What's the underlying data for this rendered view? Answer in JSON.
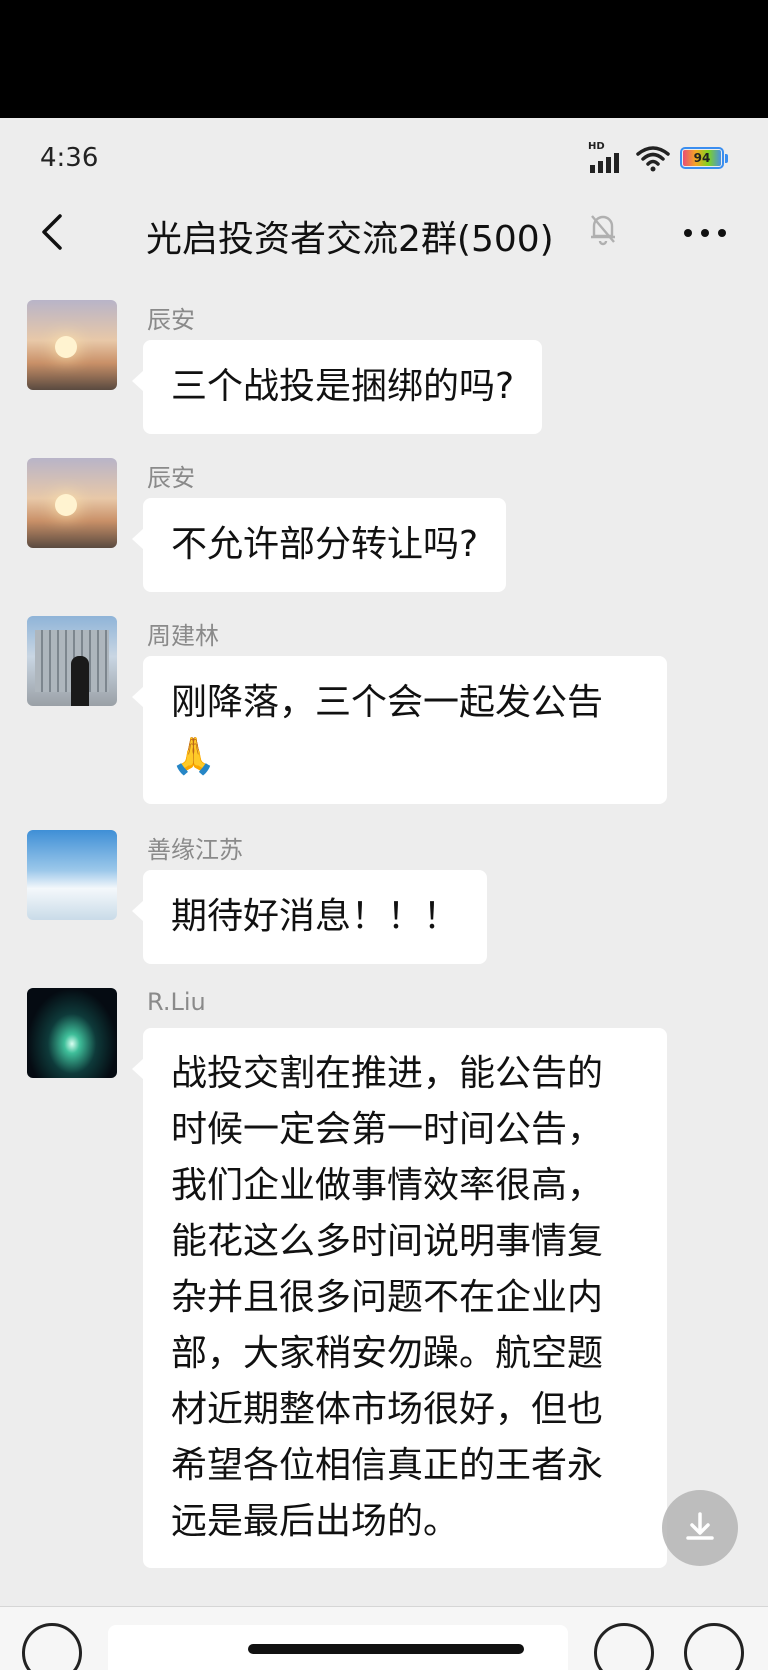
{
  "status_bar": {
    "time": "4:36",
    "network_label": "HD",
    "battery_level": "94",
    "icons": [
      "signal-icon",
      "wifi-icon",
      "battery-icon"
    ]
  },
  "header": {
    "title": "光启投资者交流2群(500)",
    "icons": [
      "back-arrow-icon",
      "mute-bell-icon",
      "more-dots-icon"
    ]
  },
  "messages": [
    {
      "sender": "辰安",
      "avatar": "sunset-mountain-avatar",
      "text": "三个战投是捆绑的吗?"
    },
    {
      "sender": "辰安",
      "avatar": "sunset-mountain-avatar",
      "text": "不允许部分转让吗?"
    },
    {
      "sender": "周建林",
      "avatar": "building-person-avatar",
      "lines": [
        "刚降落，三个会一起发公告",
        "🙏"
      ]
    },
    {
      "sender": "善缘江苏",
      "avatar": "snow-mountain-avatar",
      "text": "期待好消息！！！"
    },
    {
      "sender": "R.Liu",
      "avatar": "galaxy-avatar",
      "lines": [
        "战投交割在推进，能公告的",
        "时候一定会第一时间公告，",
        "我们企业做事情效率很高，",
        "能花这么多时间说明事情复",
        "杂并且很多问题不在企业内",
        "部，大家稍安勿躁。航空题",
        "材近期整体市场很好，但也",
        "希望各位相信真正的王者永",
        "远是最后出场的。"
      ]
    }
  ],
  "overlay": {
    "download_icon": "download-icon"
  },
  "input_bar": {
    "icons": [
      "voice-icon",
      "emoji-icon",
      "plus-icon"
    ]
  },
  "colors": {
    "background": "#ededed",
    "bubble": "#ffffff",
    "sender": "#8a8a8a"
  }
}
